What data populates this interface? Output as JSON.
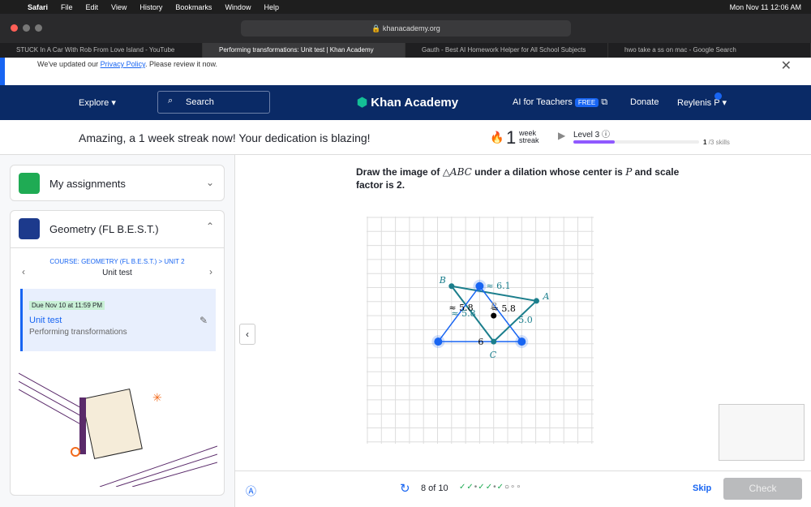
{
  "menubar": {
    "apple": "",
    "items": [
      "Safari",
      "File",
      "Edit",
      "View",
      "History",
      "Bookmarks",
      "Window",
      "Help"
    ],
    "clock": "Mon Nov 11  12:06 AM"
  },
  "browser": {
    "url": "khanacademy.org",
    "tabs": [
      "STUCK In A Car With Rob From Love Island - YouTube",
      "Performing transformations: Unit test | Khan Academy",
      "Gauth - Best AI Homework Helper for All School Subjects",
      "hwo take a ss on mac - Google Search"
    ]
  },
  "notice": {
    "text": "We've updated our ",
    "link": "Privacy Policy",
    "text2": ". Please review it now."
  },
  "nav": {
    "explore": "Explore",
    "search": "Search",
    "logo": "Khan Academy",
    "ai": "AI for Teachers",
    "free": "FREE",
    "donate": "Donate",
    "user": "Reylenis P"
  },
  "streak": {
    "message": "Amazing, a 1 week streak now! Your dedication is blazing!",
    "count": "1",
    "unit1": "week",
    "unit2": "streak",
    "level": "Level 3",
    "skills_done": "1",
    "skills_total": " /3 skills",
    "progress": 0.33
  },
  "sidebar": {
    "assignments": "My assignments",
    "course": "Geometry (FL B.E.S.T.)",
    "breadcrumb": "COURSE: GEOMETRY (FL B.E.S.T.) > UNIT 2",
    "unit": "Unit test",
    "due": "Due Nov 10 at 11:59 PM",
    "item_title": "Unit test",
    "item_sub": "Performing transformations"
  },
  "question": {
    "text1": "Draw the image of ",
    "tri": "△ABC",
    "text2": " under a dilation whose center is ",
    "P": "P",
    "text3": " and scale factor is 2."
  },
  "graph": {
    "labels": {
      "A": "A",
      "B": "B",
      "C": "C",
      "P": "P"
    },
    "measures": [
      "≈ 6.1",
      "≈ 5.8",
      "≈ 5.8",
      "≈ 5.8",
      "5.0",
      "6"
    ],
    "colors": {
      "original": "#1b7e8c",
      "image": "#1865f2"
    }
  },
  "footer": {
    "progress": "8 of 10",
    "dots": [
      "check",
      "check",
      "dot",
      "check",
      "check",
      "dot",
      "check",
      "current",
      "empty",
      "empty"
    ],
    "skip": "Skip",
    "check": "Check"
  }
}
